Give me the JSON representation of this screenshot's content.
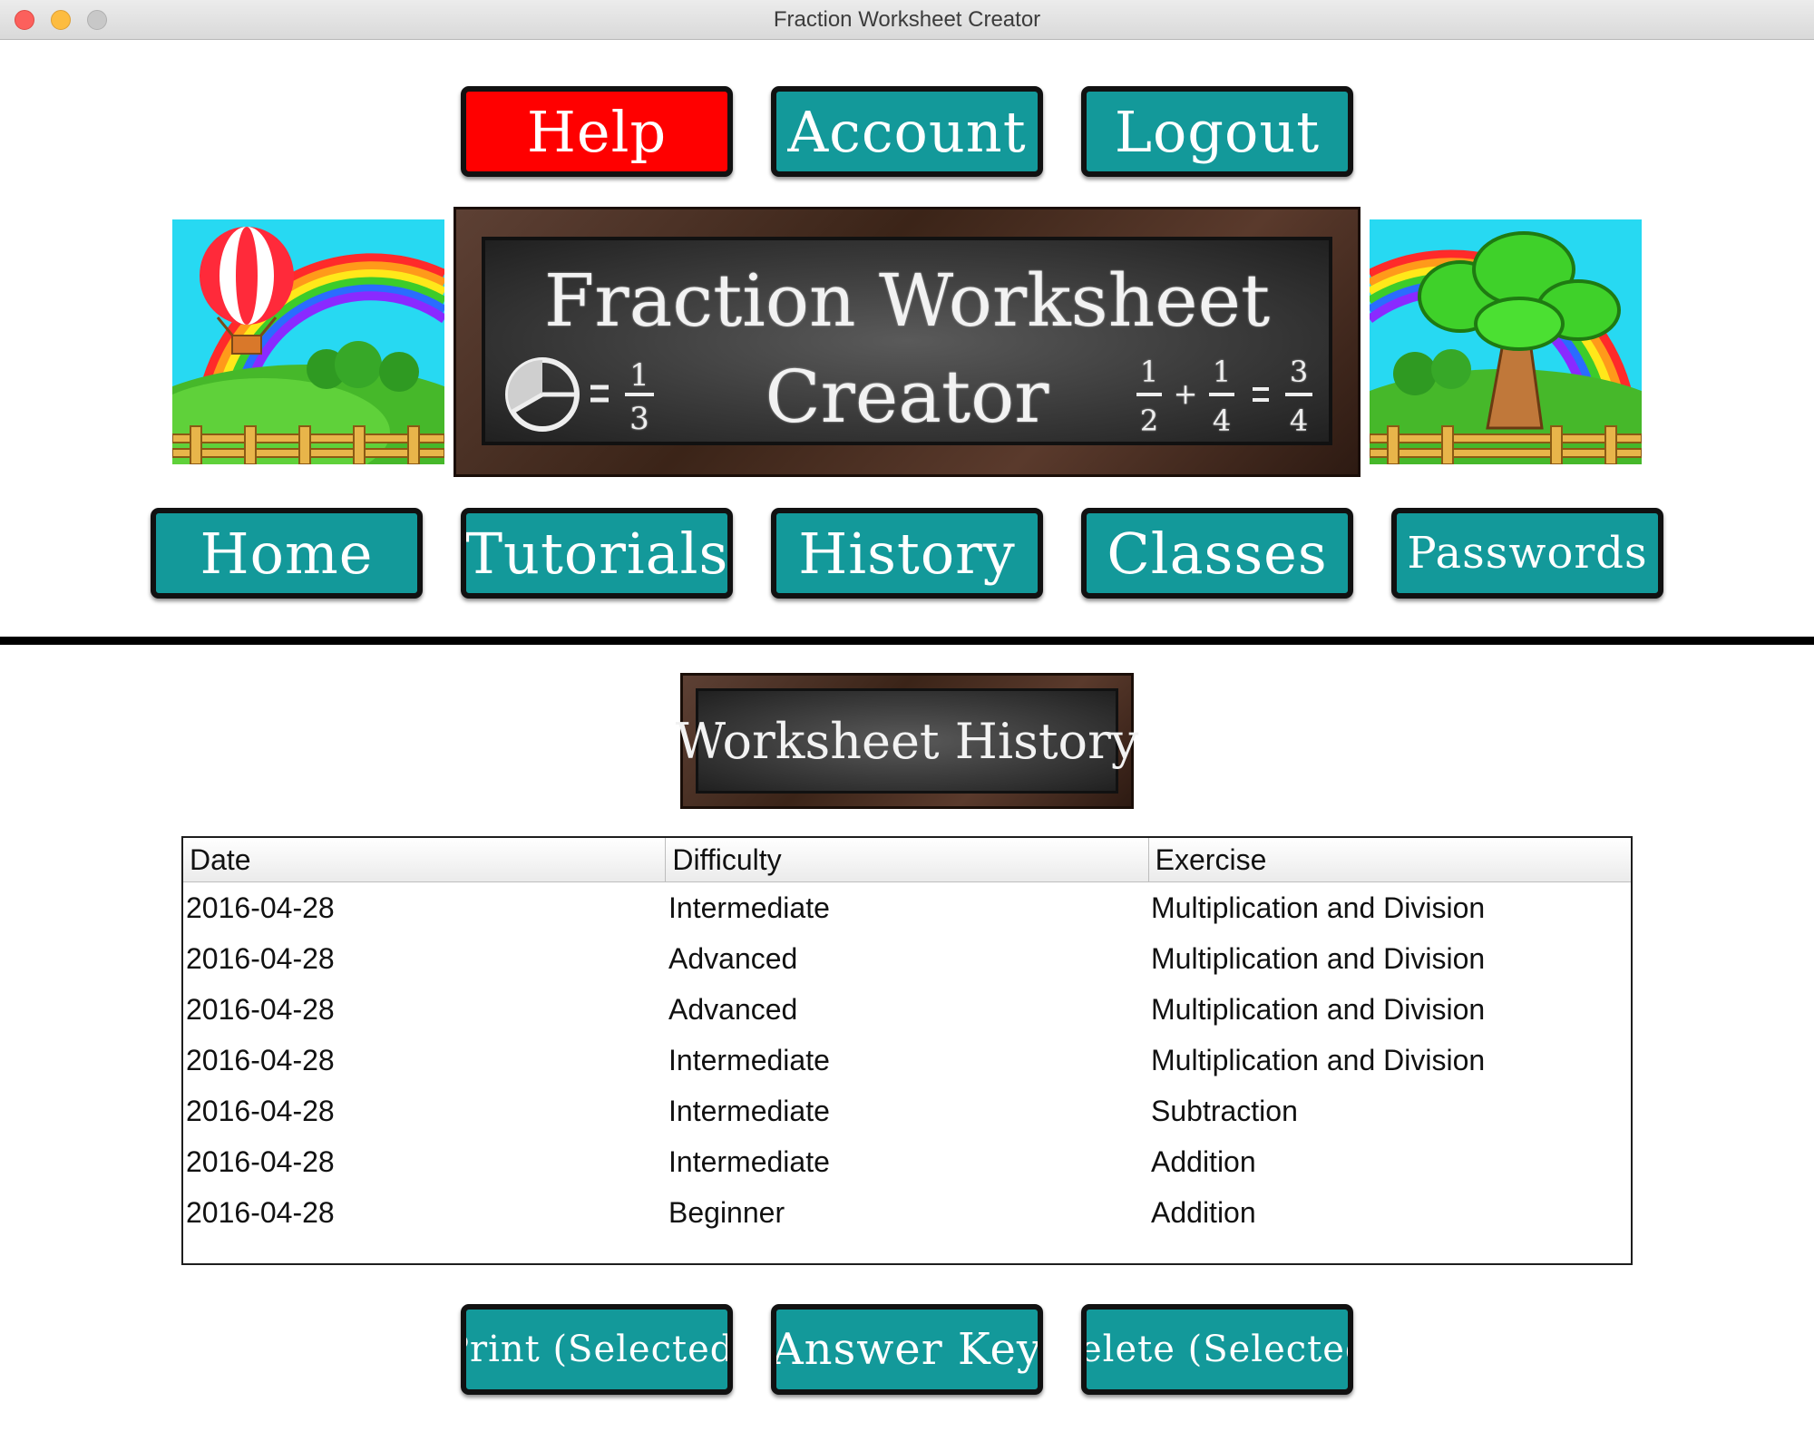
{
  "window": {
    "title": "Fraction Worksheet Creator"
  },
  "top_nav": {
    "help": "Help",
    "account": "Account",
    "logout": "Logout"
  },
  "banner": {
    "title_line1": "Fraction Worksheet",
    "title_line2": "Creator"
  },
  "main_nav": {
    "home": "Home",
    "tutorials": "Tutorials",
    "history": "History",
    "classes": "Classes",
    "passwords": "Passwords"
  },
  "section": {
    "title": "Worksheet History"
  },
  "history_table": {
    "headers": [
      "Date",
      "Difficulty",
      "Exercise"
    ],
    "rows": [
      [
        "2016-04-28",
        "Intermediate",
        "Multiplication and Division"
      ],
      [
        "2016-04-28",
        "Advanced",
        "Multiplication and Division"
      ],
      [
        "2016-04-28",
        "Advanced",
        "Multiplication and Division"
      ],
      [
        "2016-04-28",
        "Intermediate",
        "Multiplication and Division"
      ],
      [
        "2016-04-28",
        "Intermediate",
        "Subtraction"
      ],
      [
        "2016-04-28",
        "Intermediate",
        "Addition"
      ],
      [
        "2016-04-28",
        "Beginner",
        "Addition"
      ]
    ]
  },
  "actions": {
    "print": "Print (Selected)",
    "answer_key": "Answer Key",
    "delete": "Delete (Selected)"
  },
  "colors": {
    "button_teal": "#13999a",
    "help_red": "#ff0000"
  }
}
